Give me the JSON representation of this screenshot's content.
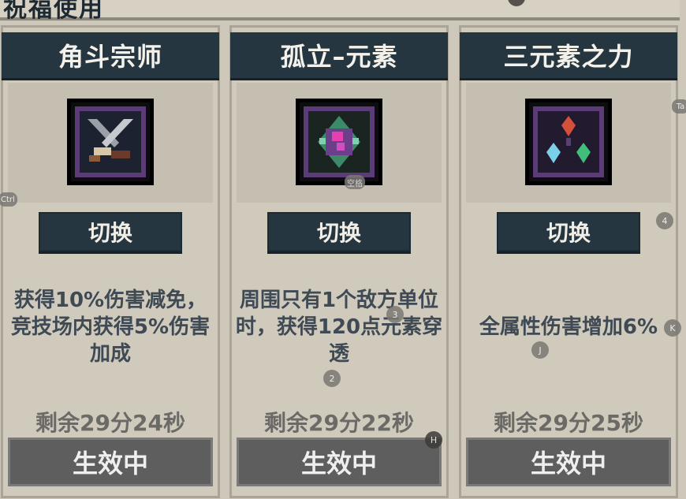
{
  "header": {
    "title": "祝福使用"
  },
  "cards": [
    {
      "title": "角斗宗师",
      "icon": "crossed-swords-icon",
      "switch_label": "切换",
      "description": "获得10%伤害减免，竞技场内获得5%伤害加成",
      "remaining": "剩余29分24秒",
      "status_label": "生效中"
    },
    {
      "title": "孤立–元素",
      "icon": "element-orb-icon",
      "switch_label": "切换",
      "description": "周围只有1个敌方单位时，获得120点元素穿透",
      "remaining": "剩余29分22秒",
      "status_label": "生效中"
    },
    {
      "title": "三元素之力",
      "icon": "three-crystals-icon",
      "switch_label": "切换",
      "description": "全属性伤害增加6%",
      "remaining": "剩余29分25秒",
      "status_label": "生效中"
    }
  ],
  "key_hints": {
    "ctrl": "Ctrl",
    "space": "空格",
    "three": "3",
    "two": "2",
    "four": "4",
    "k": "K",
    "j": "J",
    "h": "H",
    "tab_partial": "Ta"
  },
  "colors": {
    "panel_bg": "#cfcabb",
    "title_bar": "#263640",
    "active_button": "#5e5e5e",
    "description_text": "#3f4a55"
  }
}
